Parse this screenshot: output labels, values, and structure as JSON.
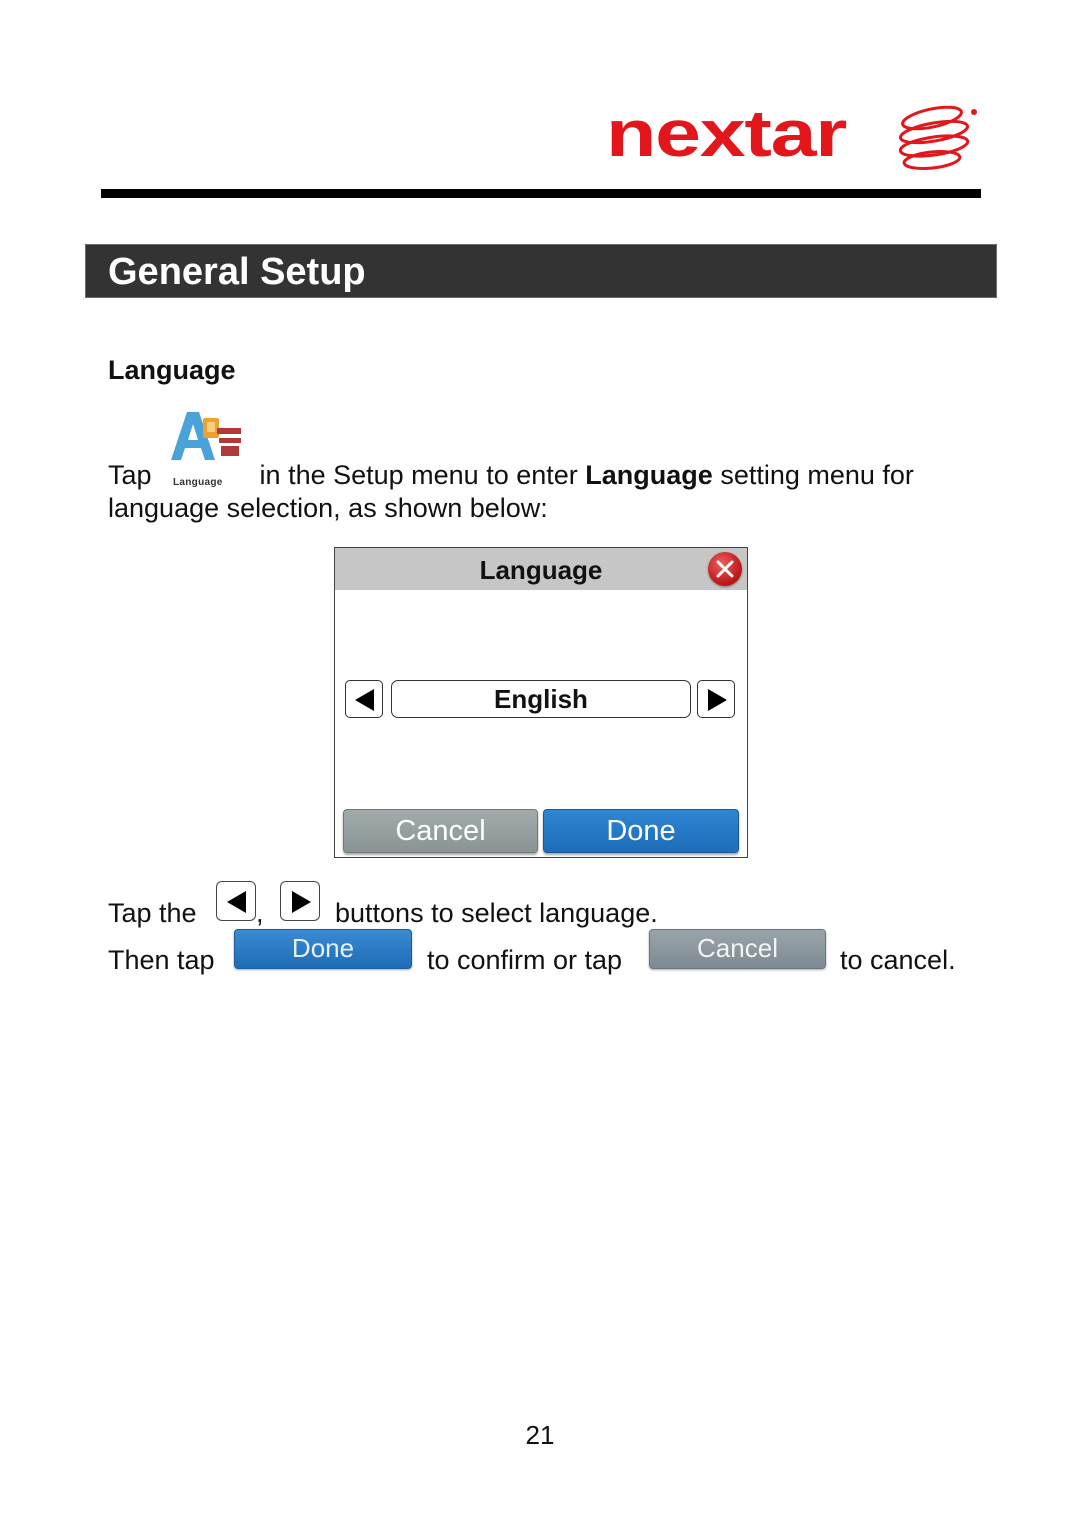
{
  "brand": {
    "logo_text": "nextar",
    "logo_color": "#e3161b"
  },
  "section": {
    "title": "General Setup",
    "bar_color": "#333333"
  },
  "subsection": {
    "heading": "Language"
  },
  "intro": {
    "tap": "Tap",
    "icon_caption": "Language",
    "icon_name": "language-icon",
    "text_before_bold": "in the Setup menu to enter",
    "bold": "Language",
    "text_after_bold": "setting menu for",
    "line2": "language selection, as shown below:"
  },
  "dialog": {
    "title": "Language",
    "close_icon": "close-icon",
    "selected_language": "English",
    "prev_icon": "triangle-left-icon",
    "next_icon": "triangle-right-icon",
    "cancel_label": "Cancel",
    "done_label": "Done",
    "colors": {
      "header": "#c6c6c6",
      "cancel": "#8a9494",
      "done": "#1d6cb8"
    }
  },
  "instructions": {
    "line1_start": "Tap the",
    "line1_comma": ",",
    "line1_end": "buttons to select language.",
    "line2_start": "Then tap",
    "done_label": "Done",
    "line2_mid": "to confirm or tap",
    "cancel_label": "Cancel",
    "line2_end": "to cancel."
  },
  "footer": {
    "page_number": "21"
  }
}
